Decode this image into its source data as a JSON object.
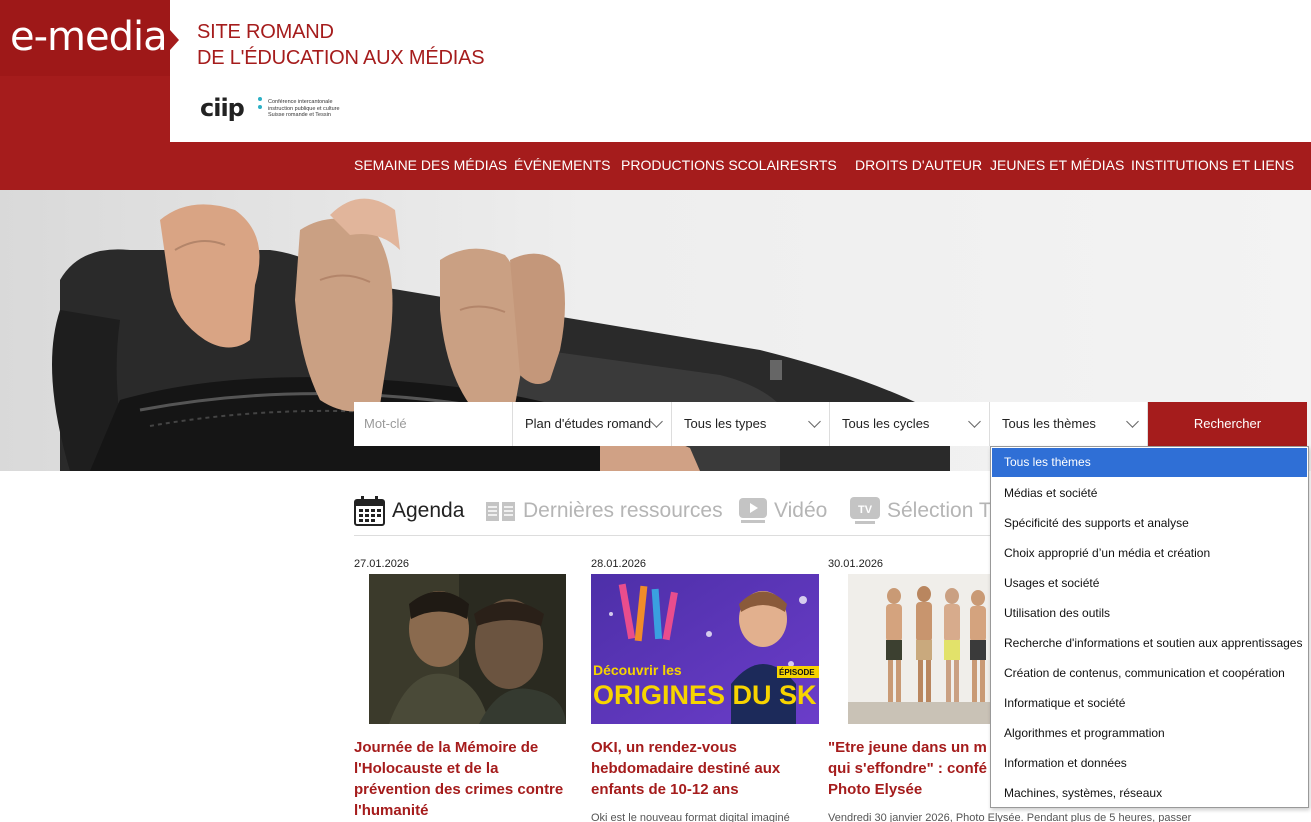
{
  "header": {
    "logo": "e-media",
    "title_line1": "SITE ROMAND",
    "title_line2": "DE L'ÉDUCATION AUX MÉDIAS",
    "ciip_logo": "ciip",
    "ciip_sub1": "Conférence intercantonale",
    "ciip_sub2": "instruction publique et culture",
    "ciip_sub3": "Suisse romande et Tessin"
  },
  "nav": {
    "items": [
      {
        "label": "SEMAINE DES MÉDIAS"
      },
      {
        "label": "ÉVÉNEMENTS"
      },
      {
        "label": "PRODUCTIONS SCOLAIRES"
      },
      {
        "label": "RTS"
      },
      {
        "label": "DROITS D'AUTEUR"
      },
      {
        "label": "JEUNES ET MÉDIAS"
      },
      {
        "label": "INSTITUTIONS ET LIENS"
      }
    ]
  },
  "search": {
    "keyword_placeholder": "Mot-clé",
    "plan": "Plan d'études romand",
    "types": "Tous les types",
    "cycles": "Tous les cycles",
    "themes": "Tous les thèmes",
    "button": "Rechercher"
  },
  "dropdown": {
    "options": [
      "Tous les thèmes",
      "Médias et société",
      "Spécificité des supports et analyse",
      "Choix approprié d’un média et création",
      "Usages et société",
      "Utilisation des outils",
      "Recherche d'informations et soutien aux apprentissages",
      "Création de contenus, communication et coopération",
      "Informatique et société",
      "Algorithmes et programmation",
      "Information et données",
      "Machines, systèmes, réseaux"
    ]
  },
  "tabs": [
    {
      "label": "Agenda",
      "icon": "calendar-icon"
    },
    {
      "label": "Dernières ressources",
      "icon": "book-icon"
    },
    {
      "label": "Vidéo",
      "icon": "play-icon"
    },
    {
      "label": "Sélection T",
      "icon": "tv-icon"
    }
  ],
  "cards": [
    {
      "date": "27.01.2026",
      "title_lines": [
        "Journée de la Mémoire de",
        "l'Holocauste et de la",
        "prévention des crimes contre",
        "l'humanité"
      ],
      "desc": ""
    },
    {
      "date": "28.01.2026",
      "title_lines": [
        "OKI, un rendez-vous",
        "hebdomadaire destiné aux",
        "enfants de 10-12 ans"
      ],
      "desc": "Oki est le nouveau format digital imaginé",
      "img_text1": "Découvrir les",
      "img_text2": "ORIGINES DU SK",
      "img_badge": "ÉPISODE"
    },
    {
      "date": "30.01.2026",
      "title_lines": [
        "\"Etre jeune dans un m",
        "qui s'effondre\" : confé",
        "Photo Elysée"
      ],
      "desc": "Vendredi 30 janvier 2026, Photo Elysée. Pendant plus de 5 heures, passer"
    }
  ],
  "colors": {
    "brand": "#a51c1c",
    "selected": "#2f6fd6",
    "ciip_dots": "#2bb0c5"
  }
}
